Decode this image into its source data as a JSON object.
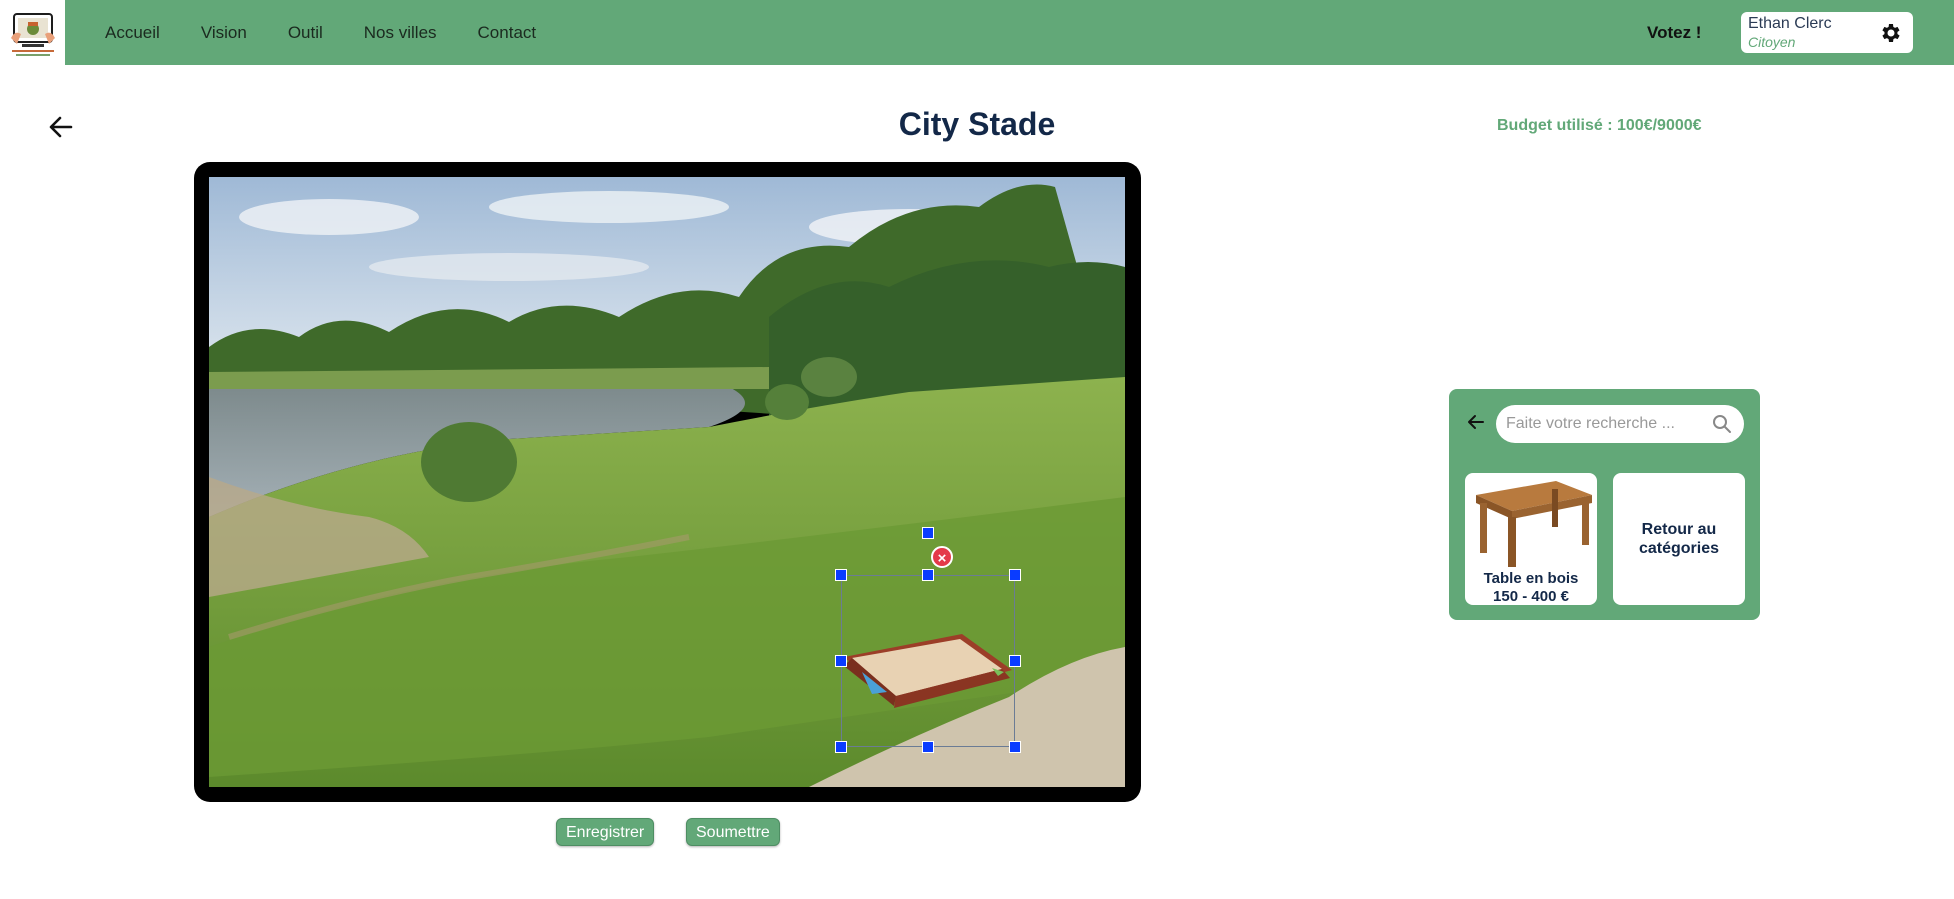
{
  "nav": {
    "links": [
      "Accueil",
      "Vision",
      "Outil",
      "Nos villes",
      "Contact"
    ],
    "vote_label": "Votez !"
  },
  "user": {
    "name": "Ethan Clerc",
    "role": "Citoyen"
  },
  "page": {
    "title": "City Stade",
    "budget": "Budget utilisé : 100€/9000€"
  },
  "actions": {
    "save_label": "Enregistrer",
    "submit_label": "Soumettre"
  },
  "catalog": {
    "search_placeholder": "Faite votre recherche ...",
    "items": [
      {
        "title": "Table en bois",
        "price": "150 - 400 €",
        "icon": "wooden-table"
      }
    ],
    "back_card_label_line1": "Retour au",
    "back_card_label_line2": "catégories"
  },
  "colors": {
    "brand_green": "#62a878",
    "title_navy": "#132848",
    "handle_blue": "#0a3cff",
    "delete_red": "#e43a4a"
  },
  "icons": [
    "gear-icon",
    "back-arrow-icon",
    "search-icon",
    "close-icon"
  ]
}
